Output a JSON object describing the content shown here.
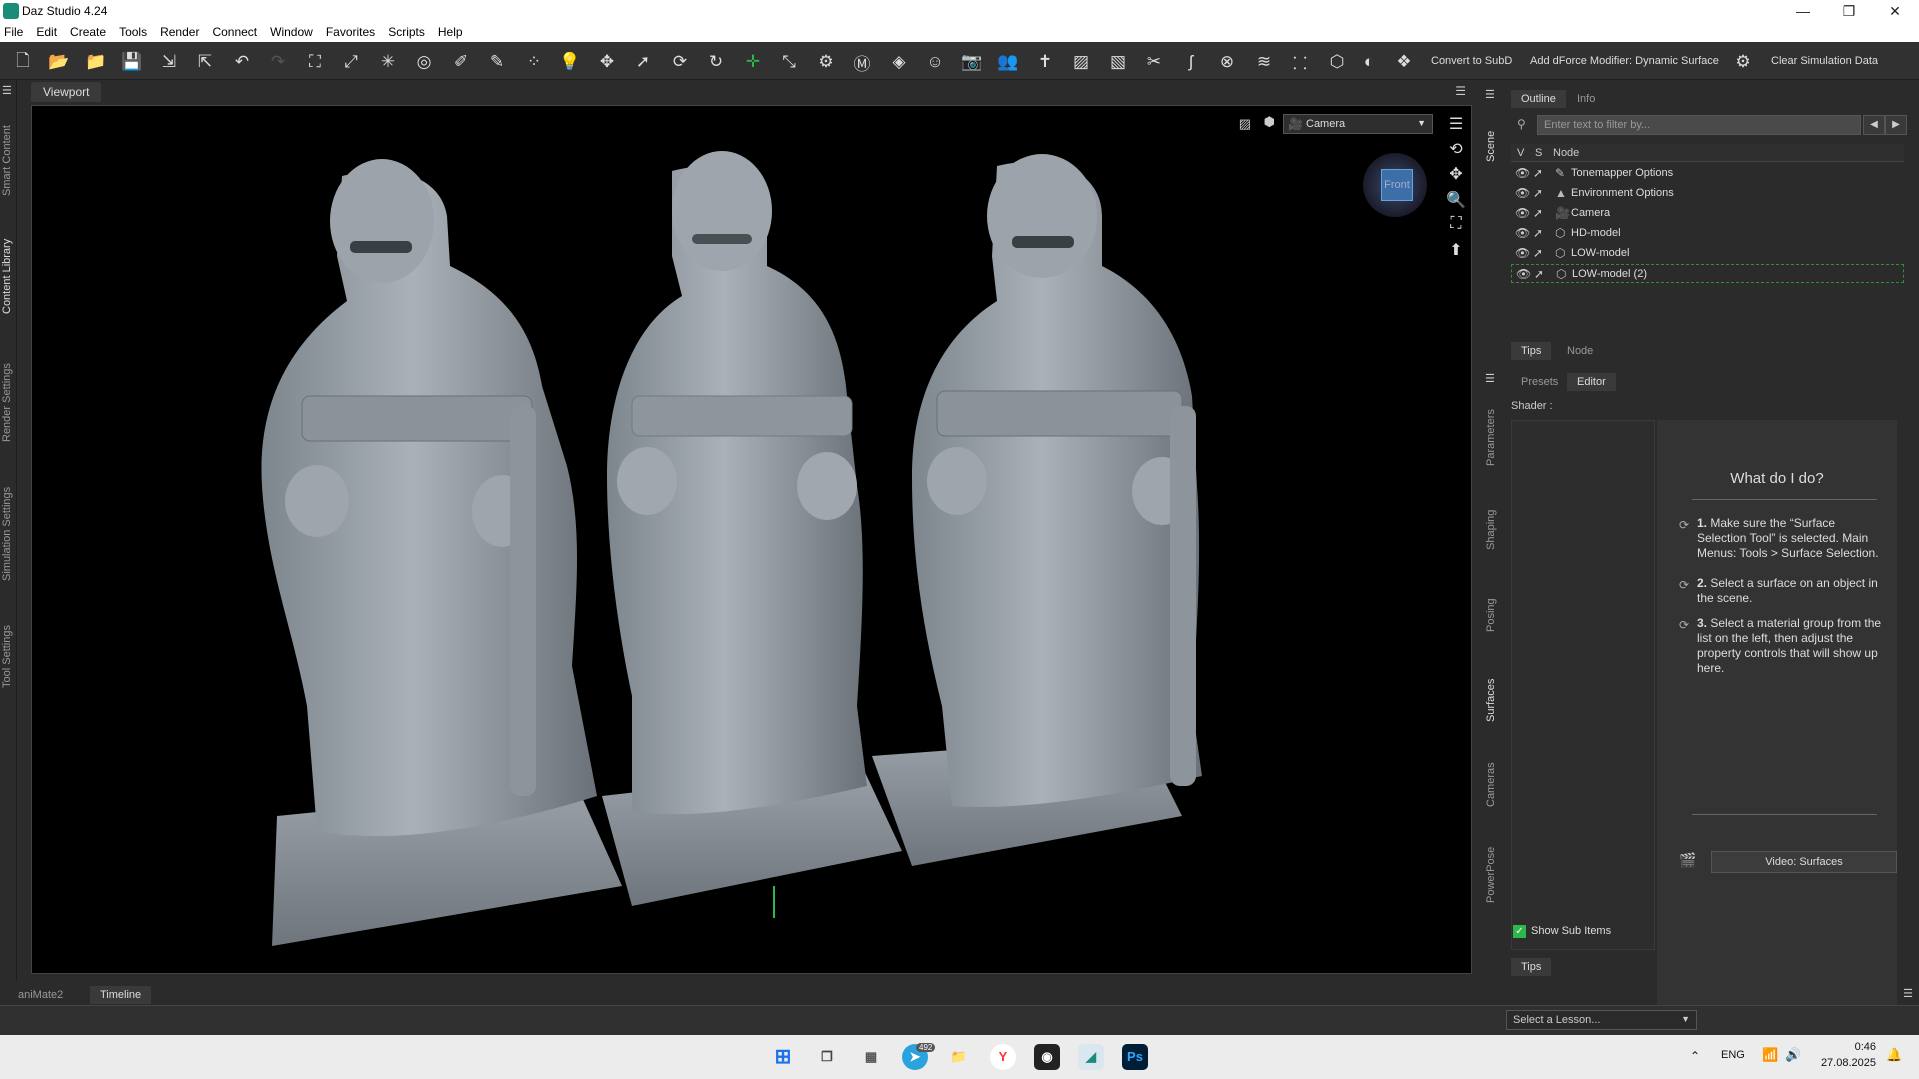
{
  "window": {
    "title": "Daz Studio 4.24"
  },
  "menu": [
    "File",
    "Edit",
    "Create",
    "Tools",
    "Render",
    "Connect",
    "Window",
    "Favorites",
    "Scripts",
    "Help"
  ],
  "toolbar": {
    "convert_subd": "Convert to SubD",
    "add_dforce": "Add dForce Modifier: Dynamic Surface",
    "clear_sim": "Clear Simulation Data"
  },
  "left_tabs": [
    "Smart Content",
    "Content Library",
    "Render Settings",
    "Simulation Settings",
    "Tool Settings"
  ],
  "viewport": {
    "tab": "Viewport",
    "camera": "Camera",
    "cube_face": "Front"
  },
  "right_tabs": [
    "Scene",
    "Parameters",
    "Shaping",
    "Posing",
    "Surfaces",
    "Cameras",
    "PowerPose"
  ],
  "scene": {
    "tabs": [
      "Outline",
      "Info"
    ],
    "filter_placeholder": "Enter text to filter by...",
    "columns": [
      "V",
      "S",
      "Node"
    ],
    "nodes": [
      "Tonemapper Options",
      "Environment Options",
      "Camera",
      "HD-model",
      "LOW-model",
      "LOW-model (2)"
    ],
    "bottom_tabs": [
      "Tips",
      "Node"
    ]
  },
  "surfaces": {
    "tabs": [
      "Presets",
      "Editor"
    ],
    "shader_label": "Shader :",
    "help_title": "What do I do?",
    "steps": [
      {
        "num": "1.",
        "text": "Make sure the “Surface Selection Tool” is selected. Main Menus: Tools > Surface Selection."
      },
      {
        "num": "2.",
        "text": "Select a surface on an object in the scene."
      },
      {
        "num": "3.",
        "text": "Select a material group from the list on the left, then adjust the property controls that will show up here."
      }
    ],
    "video_button": "Video: Surfaces",
    "show_sub_items": "Show Sub Items",
    "tips_tab": "Tips"
  },
  "bottom": {
    "tabs": [
      "aniMate2",
      "Timeline"
    ],
    "lesson_placeholder": "Select a Lesson..."
  },
  "taskbar": {
    "telegram_badge": "492",
    "language": "ENG",
    "time": "0:46",
    "date": "27.08.2025"
  },
  "colors": {
    "accent_green": "#2fb84a",
    "selection_border": "#3a8a3a"
  }
}
